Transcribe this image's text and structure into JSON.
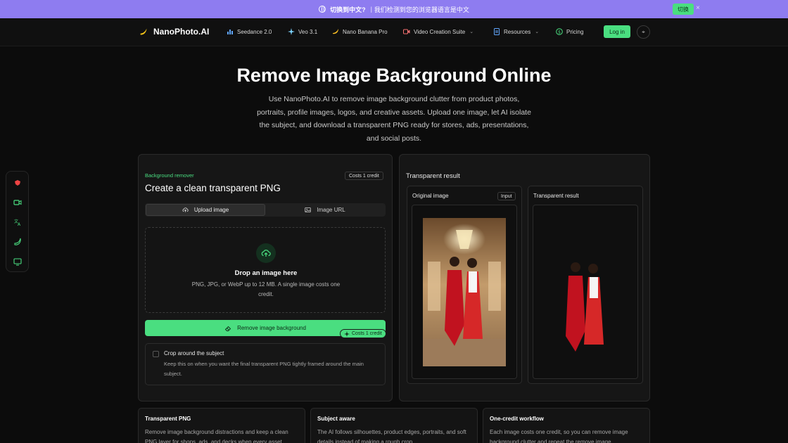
{
  "banner": {
    "switch_prompt": "切换到中文?",
    "separator": "|",
    "detected_text": "我们检测到您的浏览器语言是中文",
    "switch_button": "切换",
    "close_glyph": "×"
  },
  "nav": {
    "brand": "NanoPhoto.AI",
    "items": [
      {
        "label": "Seedance 2.0",
        "icon": "bar-chart-icon"
      },
      {
        "label": "Veo 3.1",
        "icon": "sparkle-icon"
      },
      {
        "label": "Nano Banana Pro",
        "icon": "banana-icon"
      },
      {
        "label": "Video Creation Suite",
        "icon": "video-icon",
        "dropdown": true
      },
      {
        "label": "Resources",
        "icon": "document-icon",
        "dropdown": true
      },
      {
        "label": "Pricing",
        "icon": "dollar-icon"
      }
    ],
    "login": "Log in"
  },
  "hero": {
    "title": "Remove Image Background Online",
    "subtitle": "Use NanoPhoto.AI to remove image background clutter from product photos, portraits, profile images, logos, and creative assets. Upload one image, let AI isolate the subject, and download a transparent PNG ready for stores, ads, presentations, and social posts."
  },
  "tool": {
    "eyebrow": "Background remover",
    "cost_badge": "Costs 1 credit",
    "title": "Create a clean transparent PNG",
    "tabs": [
      "Upload image",
      "Image URL"
    ],
    "active_tab": "Upload image",
    "drop_title": "Drop an image here",
    "drop_desc": "PNG, JPG, or WebP up to 12 MB. A single image costs one credit.",
    "remove_button": "Remove image background",
    "credit_pill": "Costs 1 credit",
    "crop_title": "Crop around the subject",
    "crop_desc": "Keep this on when you want the final transparent PNG tightly framed around the main subject.",
    "crop_checked": false
  },
  "result": {
    "title": "Transparent result",
    "original_label": "Original image",
    "input_tag": "Input",
    "transparent_label": "Transparent result"
  },
  "features": [
    {
      "title": "Transparent PNG",
      "desc": "Remove image background distractions and keep a clean PNG layer for shops, ads, and decks when every asset"
    },
    {
      "title": "Subject aware",
      "desc": "The AI follows silhouettes, product edges, portraits, and soft details instead of making a rough crop."
    },
    {
      "title": "One-credit workflow",
      "desc": "Each image costs one credit, so you can remove image background clutter and repeat the remove image"
    }
  ],
  "colors": {
    "accent": "#4ade80",
    "banner": "#8e7cf0",
    "background": "#0c0c0c"
  }
}
